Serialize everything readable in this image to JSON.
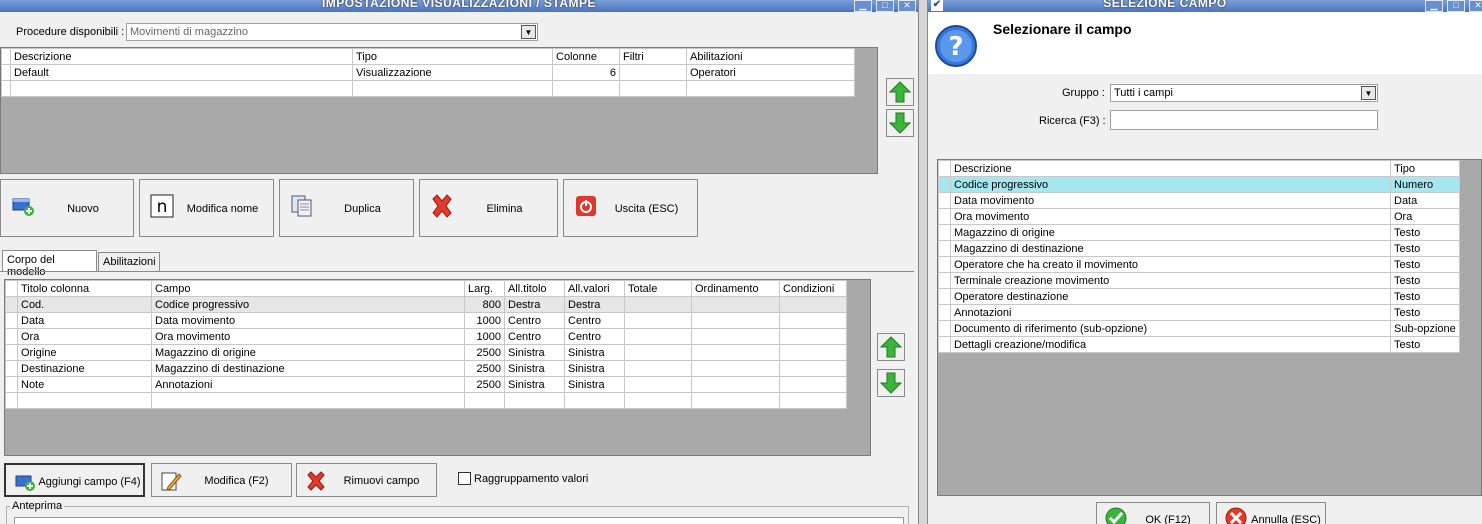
{
  "left_window": {
    "title": "IMPOSTAZIONE VISUALIZZAZIONI / STAMPE",
    "procedure_label": "Procedure disponibili :",
    "procedure_value": "Movimenti di magazzino",
    "views_table": {
      "columns": [
        "Descrizione",
        "Tipo",
        "Colonne",
        "Filtri",
        "Abilitazioni"
      ],
      "rows": [
        [
          "Default",
          "Visualizzazione",
          "6",
          "",
          "Operatori"
        ]
      ]
    },
    "buttons": {
      "nuovo": "Nuovo",
      "modifica_nome": "Modifica nome",
      "duplica": "Duplica",
      "elimina": "Elimina",
      "uscita": "Uscita (ESC)"
    },
    "tabs": [
      "Corpo del modello",
      "Abilitazioni"
    ],
    "columns_table": {
      "columns": [
        "Titolo colonna",
        "Campo",
        "Larg.",
        "All.titolo",
        "All.valori",
        "Totale",
        "Ordinamento",
        "Condizioni"
      ],
      "rows": [
        [
          "Cod.",
          "Codice progressivo",
          "800",
          "Destra",
          "Destra",
          "",
          "",
          ""
        ],
        [
          "Data",
          "Data movimento",
          "1000",
          "Centro",
          "Centro",
          "",
          "",
          ""
        ],
        [
          "Ora",
          "Ora movimento",
          "1000",
          "Centro",
          "Centro",
          "",
          "",
          ""
        ],
        [
          "Origine",
          "Magazzino di origine",
          "2500",
          "Sinistra",
          "Sinistra",
          "",
          "",
          ""
        ],
        [
          "Destinazione",
          "Magazzino di destinazione",
          "2500",
          "Sinistra",
          "Sinistra",
          "",
          "",
          ""
        ],
        [
          "Note",
          "Annotazioni",
          "2500",
          "Sinistra",
          "Sinistra",
          "",
          "",
          ""
        ]
      ]
    },
    "bottom_buttons": {
      "aggiungi": "Aggiungi campo (F4)",
      "modifica": "Modifica (F2)",
      "rimuovi": "Rimuovi campo"
    },
    "raggruppamento_label": "Raggruppamento valori",
    "anteprima_label": "Anteprima"
  },
  "right_window": {
    "title": "SELEZIONE CAMPO",
    "heading": "Selezionare il campo",
    "gruppo_label": "Gruppo :",
    "gruppo_value": "Tutti i campi",
    "ricerca_label": "Ricerca (F3) :",
    "ricerca_value": "",
    "fields_table": {
      "columns": [
        "Descrizione",
        "Tipo"
      ],
      "rows": [
        [
          "Codice progressivo",
          "Numero"
        ],
        [
          "Data movimento",
          "Data"
        ],
        [
          "Ora movimento",
          "Ora"
        ],
        [
          "Magazzino di origine",
          "Testo"
        ],
        [
          "Magazzino di destinazione",
          "Testo"
        ],
        [
          "Operatore che ha creato il movimento",
          "Testo"
        ],
        [
          "Terminale creazione movimento",
          "Testo"
        ],
        [
          "Operatore destinazione",
          "Testo"
        ],
        [
          "Annotazioni",
          "Testo"
        ],
        [
          "Documento di riferimento (sub-opzione)",
          "Sub-opzione"
        ],
        [
          "Dettagli creazione/modifica",
          "Testo"
        ]
      ]
    },
    "ok_label": "OK (F12)",
    "annulla_label": "Annulla (ESC)"
  },
  "colors": {
    "titlebar": "#4a74c4",
    "grid_background": "#a9a9a9",
    "selected_row": "#a6e6ef"
  }
}
